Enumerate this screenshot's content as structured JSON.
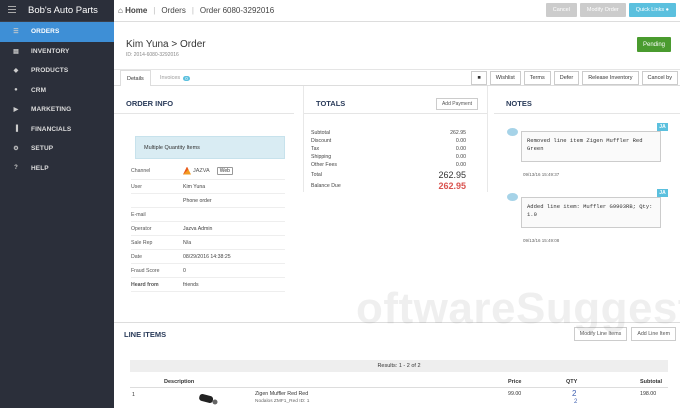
{
  "app": {
    "brand": "Bob's Auto Parts"
  },
  "sidebar": {
    "items": [
      {
        "label": "ORDERS",
        "icon": "cart-icon",
        "glyph": "☰"
      },
      {
        "label": "INVENTORY",
        "icon": "inventory-icon",
        "glyph": "▤"
      },
      {
        "label": "PRODUCTS",
        "icon": "tag-icon",
        "glyph": "◆"
      },
      {
        "label": "CRM",
        "icon": "users-icon",
        "glyph": "●"
      },
      {
        "label": "MARKETING",
        "icon": "megaphone-icon",
        "glyph": "▶"
      },
      {
        "label": "FINANCIALS",
        "icon": "chart-icon",
        "glyph": "▐"
      },
      {
        "label": "SETUP",
        "icon": "gear-icon",
        "glyph": "⚙"
      },
      {
        "label": "HELP",
        "icon": "question-icon",
        "glyph": "?"
      }
    ]
  },
  "breadcrumb": {
    "home": "Home",
    "orders": "Orders",
    "current": "Order 6080-3292016"
  },
  "topbar": {
    "cancel": "Cancel",
    "modify": "Modify Order",
    "quick_links": "Quick Links ●"
  },
  "order": {
    "title": "Kim Yuna > Order",
    "id": "ID: 2014-6080-3292016",
    "status": "Pending"
  },
  "tabs": {
    "details": "Details",
    "invoices": "Invoices",
    "invoices_count": "0"
  },
  "actions": {
    "chat": "■",
    "wishlist": "Wishlist",
    "terms": "Terms",
    "defer": "Defer",
    "release": "Release Inventory",
    "cancel_by": "Cancel by"
  },
  "order_info": {
    "heading": "ORDER INFO",
    "notice": "Multiple Quantity Items",
    "channel_label": "Channel",
    "channel_logo": "JAZVA",
    "channel_tag": "Web",
    "rows": [
      {
        "label": "User",
        "value": "Kim Yuna"
      },
      {
        "label": "",
        "value": "Phone order"
      },
      {
        "label": "E-mail",
        "value": ""
      },
      {
        "label": "Operator",
        "value": "Jazva Admin"
      },
      {
        "label": "Sale Rep",
        "value": "N/a"
      },
      {
        "label": "Date",
        "value": "08/29/2016 14:38:25"
      },
      {
        "label": "Fraud Score",
        "value": "0"
      },
      {
        "label": "Heard from",
        "value": "friends"
      }
    ]
  },
  "totals": {
    "heading": "TOTALS",
    "add_payment": "Add Payment",
    "rows": [
      {
        "label": "Subtotal",
        "value": "262.95"
      },
      {
        "label": "Discount",
        "value": "0.00"
      },
      {
        "label": "Tax",
        "value": "0.00"
      },
      {
        "label": "Shipping",
        "value": "0.00"
      },
      {
        "label": "Other Fees",
        "value": "0.00"
      }
    ],
    "total_label": "Total",
    "total_value": "262.95",
    "due_label": "Balance Due",
    "due_value": "262.95"
  },
  "notes": {
    "heading": "NOTES",
    "items": [
      {
        "initials": "JA",
        "text": "Removed line item Zigen Muffler Red Green",
        "date": "09/13/16 15:49:37"
      },
      {
        "initials": "JA",
        "text": "Added line item: Muffler G9903RB; Qty: 1.0",
        "date": "09/13/16 15:49:08"
      }
    ]
  },
  "watermark": "oftwareSuggest.com",
  "line_items": {
    "heading": "LINE ITEMS",
    "modify": "Modify Line Items",
    "add": "Add Line Item",
    "results": "Results: 1 - 2 of 2",
    "columns": {
      "description": "Description",
      "price": "Price",
      "qty": "QTY",
      "subtotal": "Subtotal"
    },
    "rows": [
      {
        "index": "1",
        "name": "Zigen Muffler Red Red",
        "sub": "Nodalos ZMF1_Red ID: 1",
        "price": "99.00",
        "qty": "2",
        "qty2": "2",
        "subtotal": "198.00"
      }
    ]
  }
}
